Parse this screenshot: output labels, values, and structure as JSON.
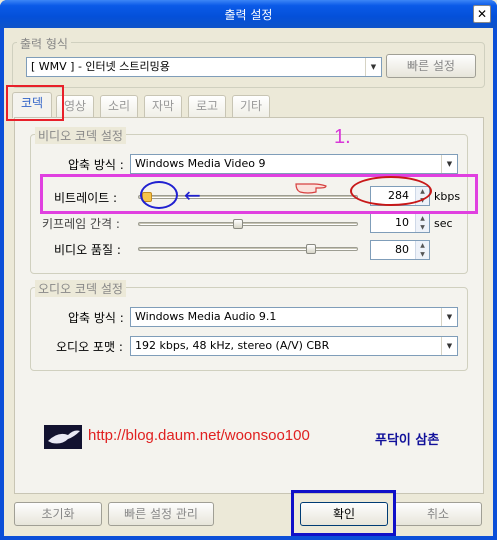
{
  "window": {
    "title": "출력 설정",
    "close_symbol": "✕"
  },
  "output_format": {
    "group_label": "출력 형식",
    "selected": "[ WMV ] - 인터넷 스트리밍용",
    "quick_setting_label": "빠른 설정"
  },
  "tabs": [
    {
      "label": "코덱",
      "active": true
    },
    {
      "label": "영상",
      "active": false
    },
    {
      "label": "소리",
      "active": false
    },
    {
      "label": "자막",
      "active": false
    },
    {
      "label": "로고",
      "active": false
    },
    {
      "label": "기타",
      "active": false
    }
  ],
  "video_codec": {
    "group_label": "비디오 코덱 설정",
    "compression_label": "압축 방식 :",
    "compression_value": "Windows Media Video 9",
    "bitrate_label": "비트레이트 :",
    "bitrate_value": "284",
    "bitrate_unit": "kbps",
    "bitrate_level": 0.02,
    "keyframe_label": "키프레임 간격 :",
    "keyframe_value": "10",
    "keyframe_unit": "sec",
    "keyframe_level": 0.45,
    "quality_label": "비디오 품질 :",
    "quality_value": "80",
    "quality_level": 0.8
  },
  "audio_codec": {
    "group_label": "오디오 코덱 설정",
    "compression_label": "압축 방식 :",
    "compression_value": "Windows Media Audio 9.1",
    "format_label": "오디오 포맷 :",
    "format_value": "192 kbps, 48 kHz, stereo (A/V) CBR"
  },
  "annotation": {
    "step_number": "1.",
    "blog_url": "http://blog.daum.net/woonsoo100",
    "blog_name": "푸닥이 삼촌",
    "highlight_colors": {
      "red": "#e8202a",
      "magenta": "#e040e0",
      "blue": "#1010c8"
    }
  },
  "footer": {
    "reset_label": "초기화",
    "manage_label": "빠른 설정 관리",
    "ok_label": "확인",
    "cancel_label": "취소"
  }
}
